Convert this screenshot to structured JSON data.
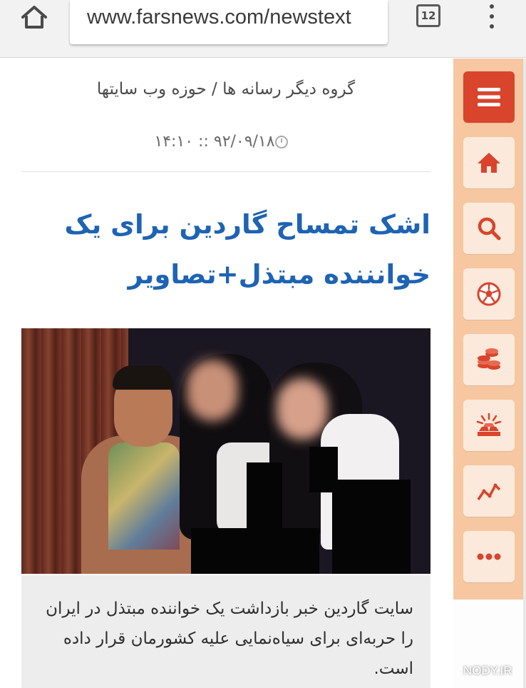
{
  "browser": {
    "url": "www.farsnews.com/newstext",
    "tab_count": "12",
    "home_icon": "home-outline-icon",
    "menu_icon": "vertical-ellipsis-icon"
  },
  "article": {
    "breadcrumb": "گروه دیگر رسانه ها / حوزه وب سایتها",
    "datetime": "۹۲/۰۹/۱۸ :: ۱۴:۱۰",
    "headline": "اشک تمساح گاردین برای یک خوانننده مبتذل+تصاویر",
    "summary": "سایت گاردین خبر بازداشت یک خواننده مبتذل در ایران را حربه‌ای برای سیاه‌نمایی علیه کشورمان قرار داده است."
  },
  "sidebar": {
    "items": [
      {
        "icon": "hamburger-menu-icon"
      },
      {
        "icon": "home-icon"
      },
      {
        "icon": "search-icon"
      },
      {
        "icon": "soccer-ball-icon"
      },
      {
        "icon": "coins-stack-icon"
      },
      {
        "icon": "gold-bars-icon"
      },
      {
        "icon": "chart-line-icon"
      },
      {
        "icon": "more-dots-icon"
      }
    ]
  },
  "watermark": {
    "text": "NODY.IR"
  },
  "colors": {
    "headline": "#1e63b4",
    "sidebar_bg": "#f6c7a0",
    "sidebar_button_bg": "#fbe9db",
    "menu_button_bg": "#d9442c",
    "icon": "#d9442c"
  }
}
